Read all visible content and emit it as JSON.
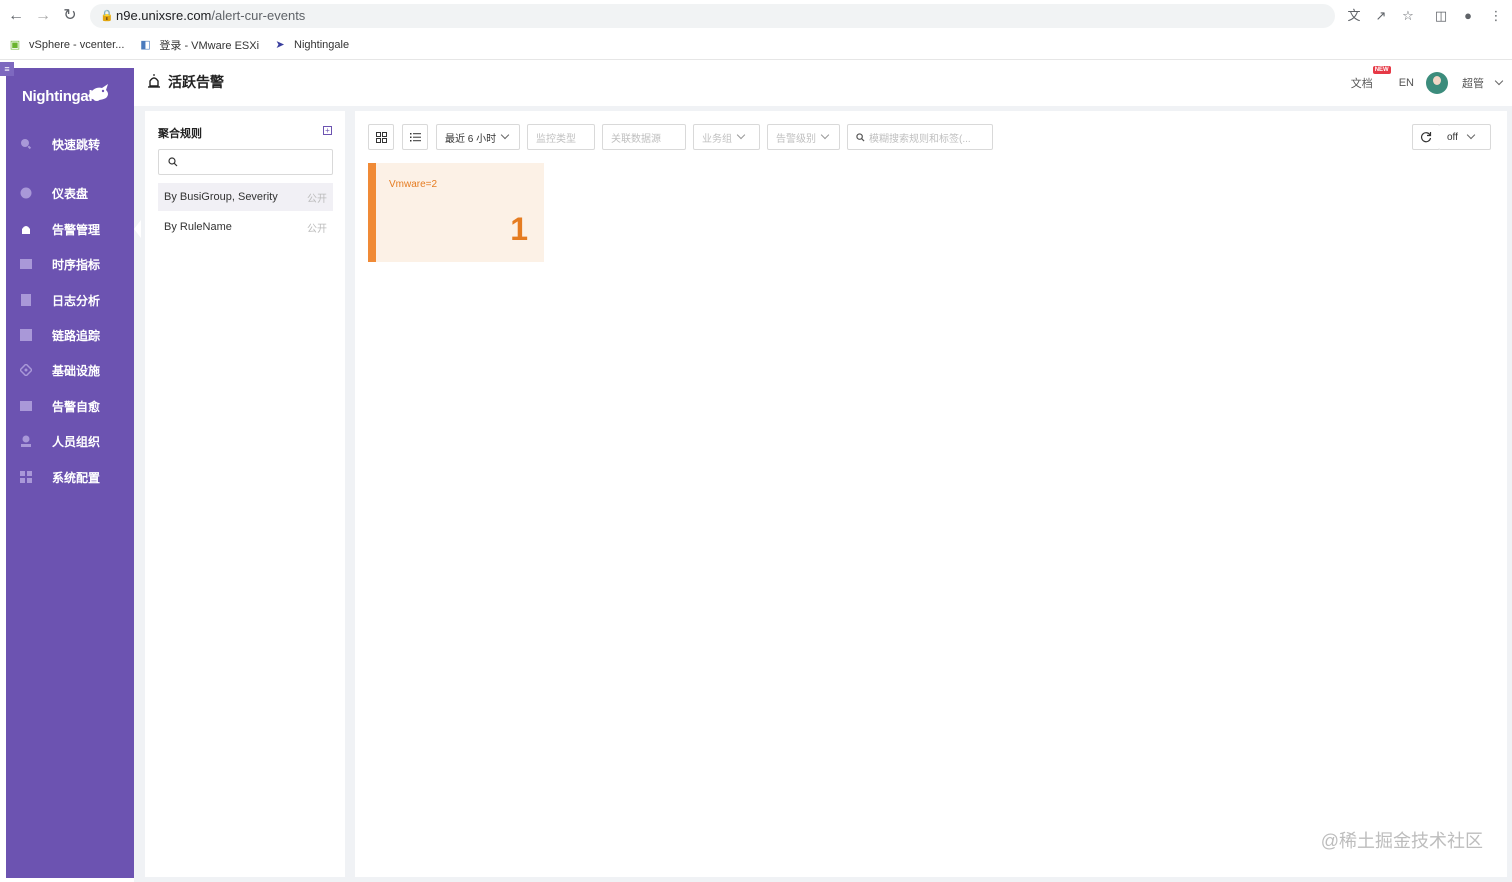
{
  "browser": {
    "url_host": "n9e.unixsre.com",
    "url_path": "/alert-cur-events",
    "bookmarks": [
      {
        "label": "vSphere - vcenter...",
        "icon": "vsphere-icon"
      },
      {
        "label": "登录 - VMware ESXi",
        "icon": "vmware-icon"
      },
      {
        "label": "Nightingale",
        "icon": "nightingale-icon"
      }
    ]
  },
  "sidebar": {
    "logo": "Nightingale",
    "items": [
      {
        "label": "快速跳转",
        "icon": "search-icon"
      },
      {
        "label": "仪表盘",
        "icon": "dashboard-icon"
      },
      {
        "label": "告警管理",
        "icon": "alarm-icon",
        "active": true
      },
      {
        "label": "时序指标",
        "icon": "chart-icon"
      },
      {
        "label": "日志分析",
        "icon": "log-icon"
      },
      {
        "label": "链路追踪",
        "icon": "trace-icon"
      },
      {
        "label": "基础设施",
        "icon": "infra-icon"
      },
      {
        "label": "告警自愈",
        "icon": "self-heal-icon"
      },
      {
        "label": "人员组织",
        "icon": "user-icon"
      },
      {
        "label": "系统配置",
        "icon": "settings-icon"
      }
    ]
  },
  "header": {
    "title": "活跃告警",
    "doc_label": "文档",
    "new_badge": "NEW",
    "lang": "EN",
    "user": "超管"
  },
  "left_panel": {
    "title": "聚合规则",
    "search_value": "",
    "rules": [
      {
        "name": "By BusiGroup, Severity",
        "visibility": "公开"
      },
      {
        "name": "By RuleName",
        "visibility": "公开"
      }
    ]
  },
  "toolbar": {
    "time_range": "最近 6 小时",
    "monitor_type_placeholder": "监控类型",
    "datasource_placeholder": "关联数据源",
    "busigroup_placeholder": "业务组",
    "severity_placeholder": "告警级别",
    "search_placeholder": "模糊搜索规则和标签(...",
    "refresh_value": "off"
  },
  "cards": [
    {
      "label": "Vmware=2",
      "count": "1",
      "color": "#f08a36"
    }
  ],
  "watermark": "@稀土掘金技术社区",
  "colors": {
    "sidebar": "#6c53b1",
    "accent": "#f08a36"
  }
}
